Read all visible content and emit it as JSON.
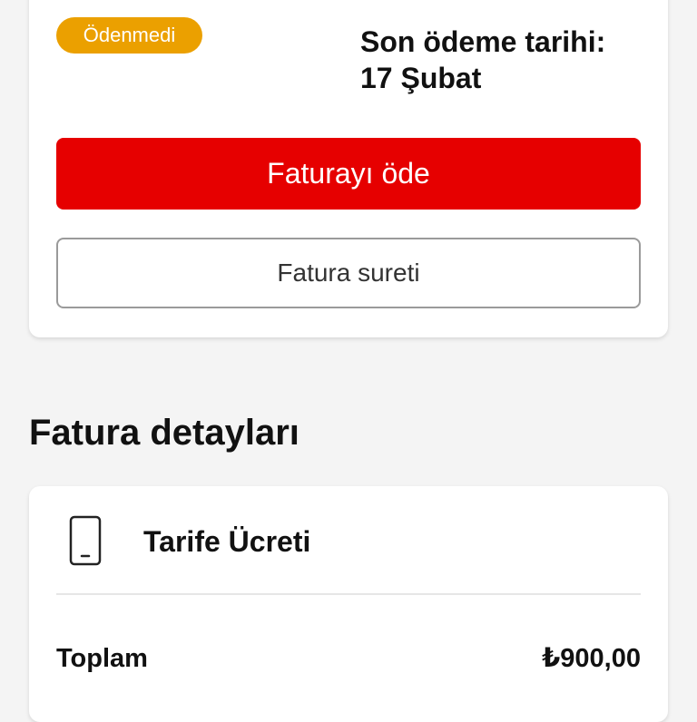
{
  "invoice": {
    "status_badge": "Ödenmedi",
    "due_date_line1": "Son ödeme tarihi:",
    "due_date_line2": "17 Şubat",
    "pay_button": "Faturayı öde",
    "copy_button": "Fatura sureti"
  },
  "details": {
    "section_title": "Fatura detayları",
    "item_icon": "phone-icon",
    "item_label": "Tarife Ücreti",
    "total_label": "Toplam",
    "total_value": "₺900,00"
  },
  "colors": {
    "accent_red": "#e60000",
    "badge_orange": "#eba000",
    "background": "#f4f4f4"
  }
}
